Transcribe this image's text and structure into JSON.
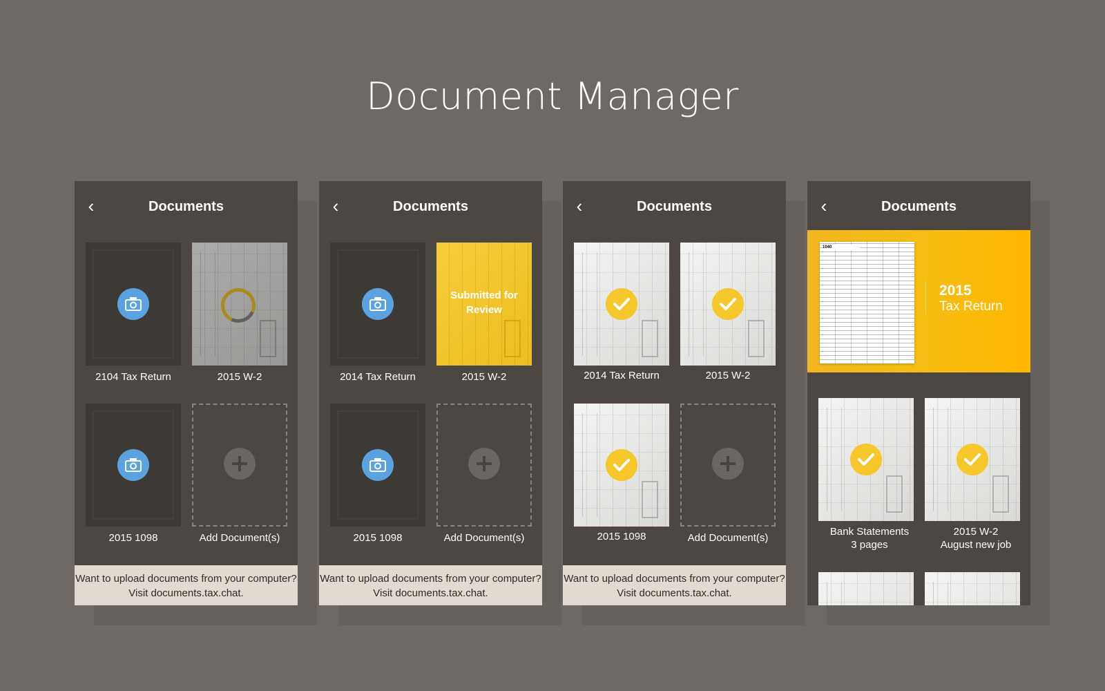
{
  "page_title": "Document Manager",
  "screens": [
    {
      "nav_title": "Documents",
      "back_icon": "‹",
      "tiles": [
        {
          "label": "2104 Tax Return"
        },
        {
          "label": "2015 W-2"
        },
        {
          "label": "2015 1098"
        },
        {
          "label": "Add Document(s)"
        }
      ],
      "footer": "Want to upload documents from your computer? Visit documents.tax.chat."
    },
    {
      "nav_title": "Documents",
      "back_icon": "‹",
      "tiles": [
        {
          "label": "2014 Tax Return"
        },
        {
          "label": "2015 W-2",
          "status": "Submitted for Review"
        },
        {
          "label": "2015 1098"
        },
        {
          "label": "Add Document(s)"
        }
      ],
      "footer": "Want to upload documents from your computer? Visit documents.tax.chat."
    },
    {
      "nav_title": "Documents",
      "back_icon": "‹",
      "tiles": [
        {
          "label": "2014 Tax Return"
        },
        {
          "label": "2015 W-2"
        },
        {
          "label": "2015 1098"
        },
        {
          "label": "Add Document(s)"
        }
      ],
      "footer": "Want to upload documents from your computer? Visit documents.tax.chat."
    },
    {
      "nav_title": "Documents",
      "back_icon": "‹",
      "hero": {
        "form_code": "1040",
        "year": "2015",
        "name": "Tax Return"
      },
      "tiles": [
        {
          "label": "Bank Statements",
          "sublabel": "3 pages"
        },
        {
          "label": "2015 W-2",
          "sublabel": "August new job"
        }
      ]
    }
  ],
  "colors": {
    "background": "#6e6964",
    "phone": "#4c4743",
    "accent_yellow": "#f5c72a",
    "camera_blue": "#5ba3e0",
    "footer": "#e2dad1"
  },
  "icons": [
    "chevron-left-icon",
    "camera-icon",
    "plus-icon",
    "check-icon",
    "loading-spinner"
  ]
}
